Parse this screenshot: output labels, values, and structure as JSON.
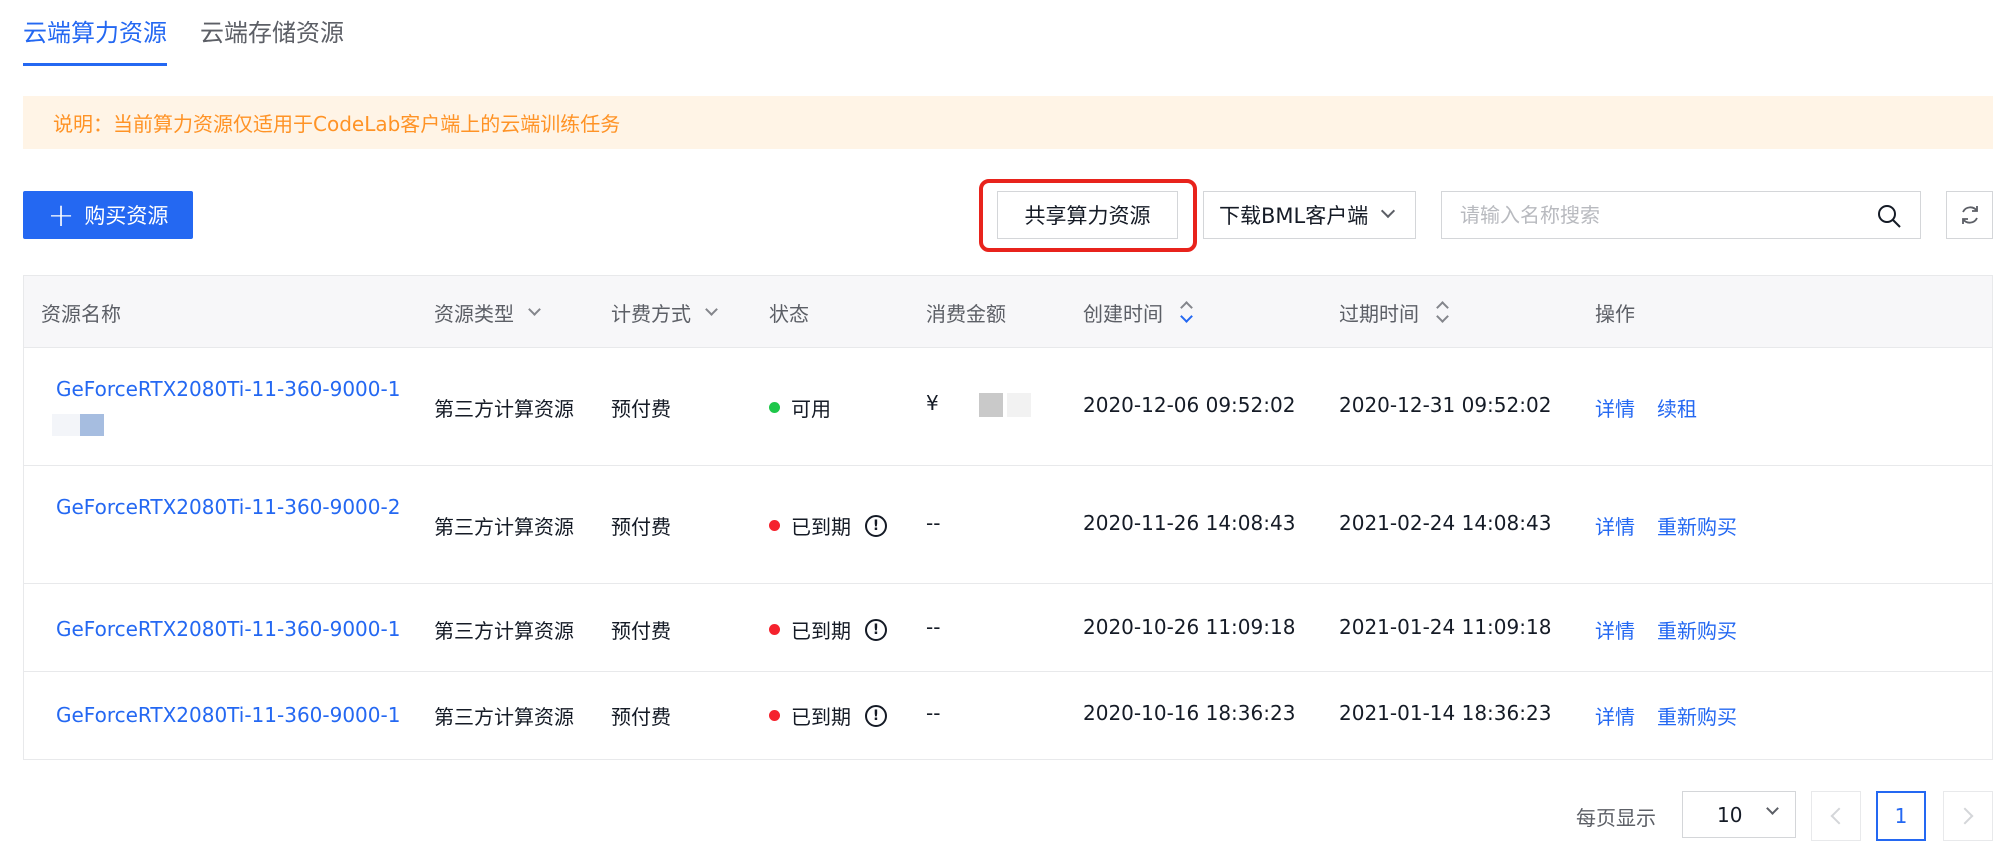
{
  "tabs": [
    {
      "label": "云端算力资源",
      "active": true
    },
    {
      "label": "云端存储资源",
      "active": false
    }
  ],
  "notice": "说明：当前算力资源仅适用于CodeLab客户端上的云端训练任务",
  "toolbar": {
    "buy_label": "购买资源",
    "share_label": "共享算力资源",
    "bml_label": "下载BML客户端",
    "search_placeholder": "请输入名称搜索"
  },
  "table": {
    "headers": {
      "name": "资源名称",
      "type": "资源类型",
      "billing": "计费方式",
      "status": "状态",
      "amount": "消费金额",
      "created": "创建时间",
      "expire": "过期时间",
      "ops": "操作"
    },
    "rows": [
      {
        "name": "GeForceRTX2080Ti-11-360-9000-1",
        "type": "第三方计算资源",
        "billing": "预付费",
        "status": "可用",
        "status_color": "#1ec74a",
        "amount": "¥",
        "created": "2020-12-06 09:52:02",
        "expire": "2020-12-31 09:52:02",
        "op1": "详情",
        "op2": "续租"
      },
      {
        "name": "GeForceRTX2080Ti-11-360-9000-2",
        "type": "第三方计算资源",
        "billing": "预付费",
        "status": "已到期",
        "status_color": "#f5222d",
        "amount": "--",
        "created": "2020-11-26 14:08:43",
        "expire": "2021-02-24 14:08:43",
        "op1": "详情",
        "op2": "重新购买"
      },
      {
        "name": "GeForceRTX2080Ti-11-360-9000-1",
        "type": "第三方计算资源",
        "billing": "预付费",
        "status": "已到期",
        "status_color": "#f5222d",
        "amount": "--",
        "created": "2020-10-26 11:09:18",
        "expire": "2021-01-24 11:09:18",
        "op1": "详情",
        "op2": "重新购买"
      },
      {
        "name": "GeForceRTX2080Ti-11-360-9000-1",
        "type": "第三方计算资源",
        "billing": "预付费",
        "status": "已到期",
        "status_color": "#f5222d",
        "amount": "--",
        "created": "2020-10-16 18:36:23",
        "expire": "2021-01-14 18:36:23",
        "op1": "详情",
        "op2": "重新购买"
      }
    ]
  },
  "pagination": {
    "per_page_label": "每页显示",
    "page_size": "10",
    "current_page": "1"
  },
  "colors": {
    "accent": "#2468f2",
    "notice_text": "#ff9326",
    "highlight_border": "#e8231c"
  }
}
